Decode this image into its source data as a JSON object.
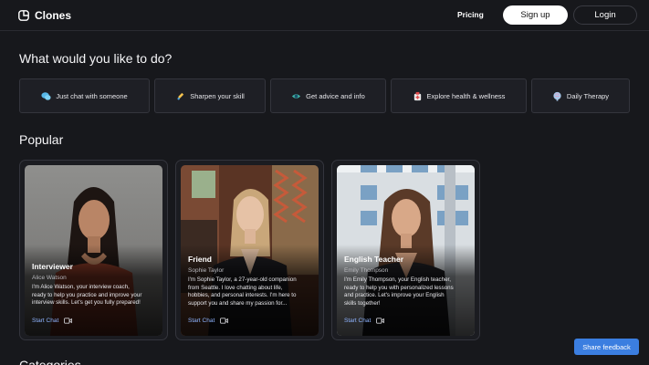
{
  "header": {
    "logo_text": "Clones",
    "pricing": "Pricing",
    "signup": "Sign up",
    "login": "Login"
  },
  "question": "What would you like to do?",
  "actions": [
    {
      "label": "Just chat with someone",
      "icon": "chat-bubbles-icon"
    },
    {
      "label": "Sharpen your skill",
      "icon": "pencil-skill-icon"
    },
    {
      "label": "Get advice and info",
      "icon": "eye-advice-icon"
    },
    {
      "label": "Explore health & wellness",
      "icon": "health-icon"
    },
    {
      "label": "Daily Therapy",
      "icon": "brain-therapy-icon"
    }
  ],
  "popular_heading": "Popular",
  "cards": [
    {
      "role": "Interviewer",
      "name": "Alice Watson",
      "desc_lines": [
        "I'm Alice Watson, your interview coach,",
        "ready to help you practice and improve your",
        "interview skills. Let's get you fully prepared!"
      ],
      "start": "Start Chat"
    },
    {
      "role": "Friend",
      "name": "Sophie Taylor",
      "desc_lines": [
        "I'm Sophie Taylor, a 27-year-old companion",
        "from Seattle. I love chatting about life,",
        "hobbies, and personal interests. I'm here to",
        "support you and share my passion for..."
      ],
      "start": "Start Chat"
    },
    {
      "role": "English Teacher",
      "name": "Emily Thompson",
      "desc_lines": [
        "I'm Emily Thompson, your English teacher,",
        "ready to help you with personalized lessons",
        "and practice. Let's improve your English",
        "skills together!"
      ],
      "start": "Start Chat"
    }
  ],
  "categories_heading": "Categories",
  "feedback": "Share feedback",
  "colors": {
    "background": "#17181c",
    "accent_blue": "#3b7ee0",
    "link_blue": "#8fb4ff"
  }
}
